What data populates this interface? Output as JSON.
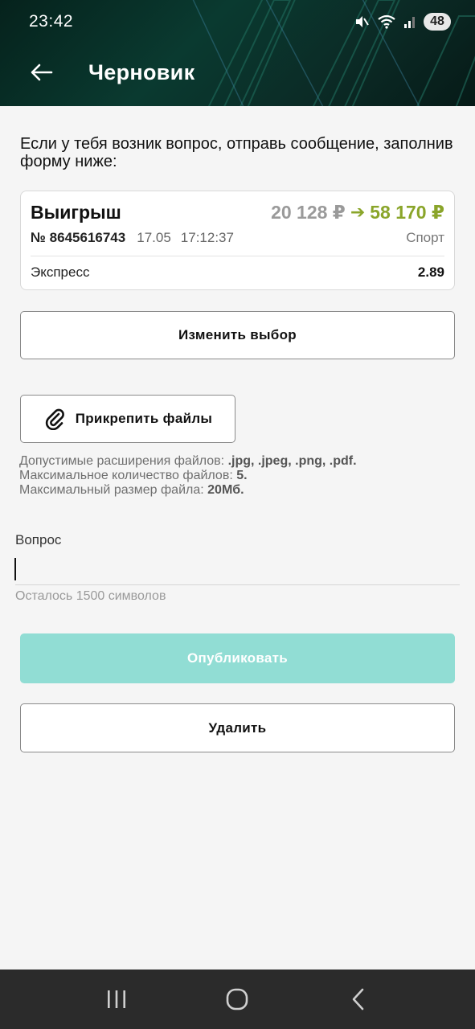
{
  "status_bar": {
    "time": "23:42",
    "battery": "48"
  },
  "header": {
    "title": "Черновик"
  },
  "intro_text": "Если у тебя возник вопрос, отправь сообщение, заполнив форму ниже:",
  "bet": {
    "status": "Выигрыш",
    "amount_old": "20 128 ₽",
    "arrow": "➔",
    "amount_new": "58 170 ₽",
    "number": "№ 8645616743",
    "date": "17.05",
    "time": "17:12:37",
    "sport": "Спорт",
    "type": "Экспресс",
    "coefficient": "2.89"
  },
  "buttons": {
    "change_choice": "Изменить выбор",
    "attach_files": "Прикрепить файлы",
    "publish": "Опубликовать",
    "delete": "Удалить"
  },
  "file_info": {
    "extensions_label": "Допустимые расширения файлов: ",
    "extensions_value": ".jpg, .jpeg, .png, .pdf.",
    "max_count_label": "Максимальное количество файлов: ",
    "max_count_value": "5.",
    "max_size_label": "Максимальный размер файла: ",
    "max_size_value": "20Мб."
  },
  "question": {
    "label": "Вопрос",
    "value": "",
    "hint": "Осталось 1500 символов"
  },
  "colors": {
    "header_bg": "#0a3a30",
    "win_green": "#8aa52a",
    "publish_disabled": "#91ddd4",
    "nav_bar": "#2b2b2b"
  }
}
